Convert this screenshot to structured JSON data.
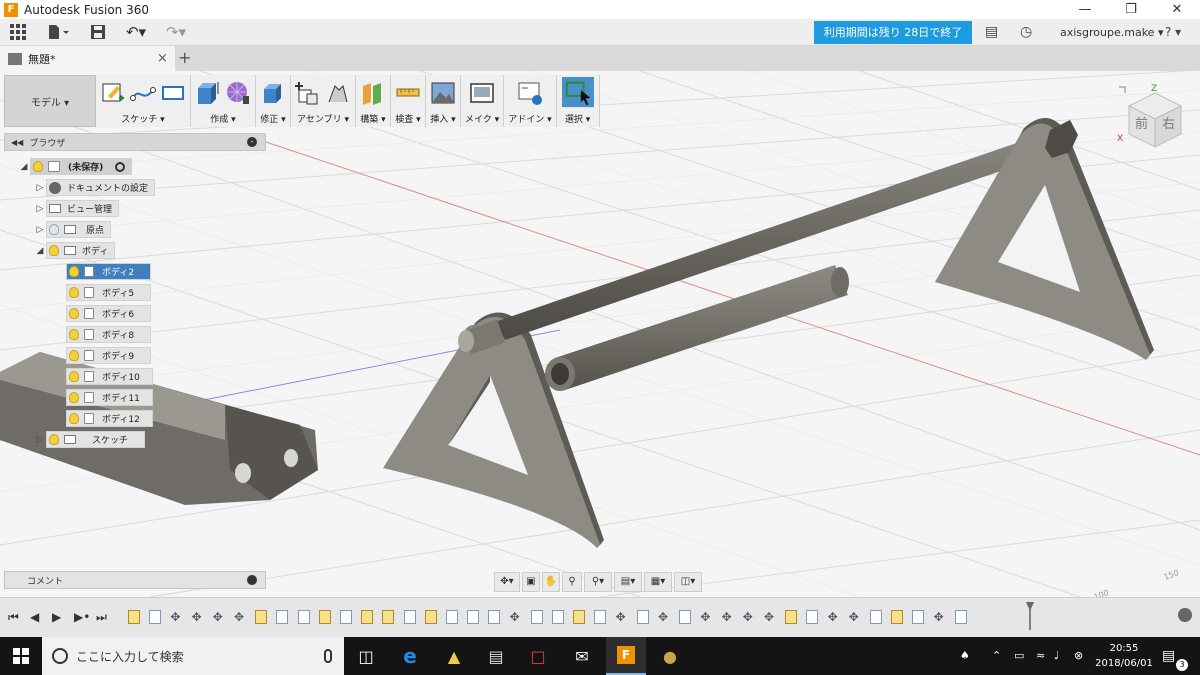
{
  "window": {
    "title": "Autodesk Fusion 360",
    "controls": [
      "minimize-icon",
      "restore-icon",
      "close-icon"
    ]
  },
  "quick_access": {
    "trial_banner": "利用期間は残り 28日で終了し...",
    "account": "axisgroupe.make ▾",
    "help": "? ▾"
  },
  "tab": {
    "label": "無題*",
    "close": "×",
    "new": "+"
  },
  "toolbar": {
    "workspace": "モデル ▾",
    "groups": [
      {
        "name": "スケッチ ▾"
      },
      {
        "name": "作成 ▾"
      },
      {
        "name": "修正 ▾"
      },
      {
        "name": "アセンブリ ▾"
      },
      {
        "name": "構築 ▾"
      },
      {
        "name": "検査 ▾"
      },
      {
        "name": "挿入 ▾"
      },
      {
        "name": "メイク ▾"
      },
      {
        "name": "アドイン ▾"
      },
      {
        "name": "選択 ▾"
      }
    ]
  },
  "browser": {
    "title": "ブラウザ",
    "root": "(未保存)",
    "nodes": [
      {
        "label": "ドキュメントの設定"
      },
      {
        "label": "ビュー管理"
      },
      {
        "label": "原点"
      },
      {
        "label": "ボディ"
      }
    ],
    "bodies": [
      "ボディ2",
      "ボディ5",
      "ボディ6",
      "ボディ8",
      "ボディ9",
      "ボディ10",
      "ボディ11",
      "ボディ12"
    ],
    "sketch": "スケッチ"
  },
  "comment": {
    "label": "コメント"
  },
  "viewcube": {
    "front": "前",
    "right": "右",
    "axis_z": "Z",
    "axis_x": "X"
  },
  "taskbar": {
    "search_placeholder": "ここに入力して検索",
    "time": "20:55",
    "date": "2018/06/01",
    "notifications": "3"
  },
  "colors": {
    "accent": "#1e9adf",
    "selection": "#3f7fbf",
    "part": "#7a7670"
  }
}
